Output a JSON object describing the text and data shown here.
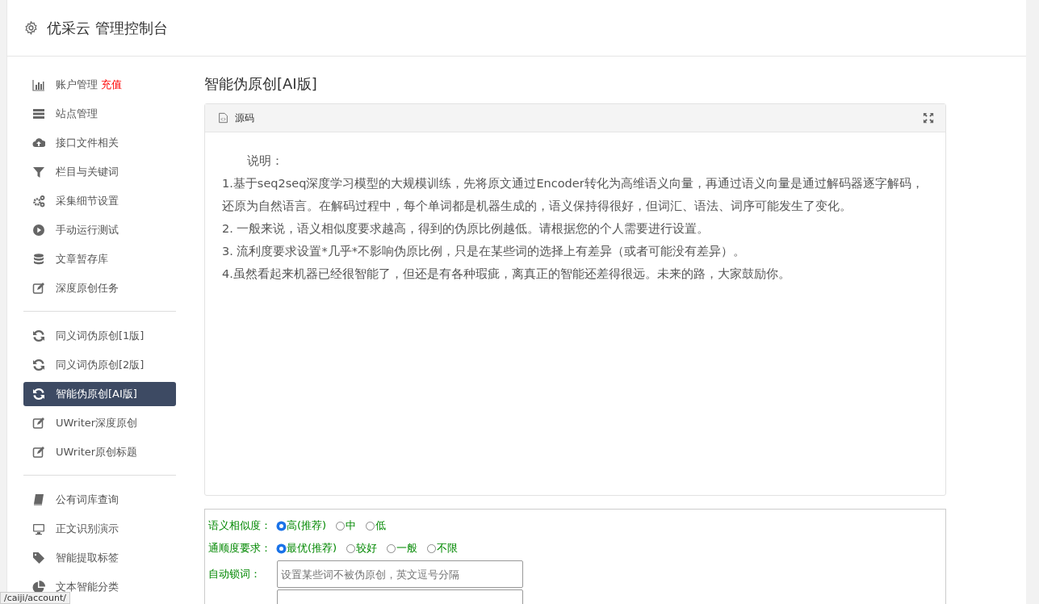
{
  "header": {
    "title": "优采云 管理控制台"
  },
  "sidebar": {
    "groups": [
      {
        "items": [
          {
            "label": "账户管理",
            "badge": "充值",
            "selected": false
          },
          {
            "label": "站点管理",
            "selected": false
          },
          {
            "label": "接口文件相关",
            "selected": false
          },
          {
            "label": "栏目与关键词",
            "selected": false
          },
          {
            "label": "采集细节设置",
            "selected": false
          },
          {
            "label": "手动运行测试",
            "selected": false
          },
          {
            "label": "文章暂存库",
            "selected": false
          },
          {
            "label": "深度原创任务",
            "selected": false
          }
        ]
      },
      {
        "items": [
          {
            "label": "同义词伪原创[1版]",
            "selected": false
          },
          {
            "label": "同义词伪原创[2版]",
            "selected": false
          },
          {
            "label": "智能伪原创[AI版]",
            "selected": true
          },
          {
            "label": "UWriter深度原创",
            "selected": false
          },
          {
            "label": "UWriter原创标题",
            "selected": false
          }
        ]
      },
      {
        "items": [
          {
            "label": "公有词库查询",
            "selected": false
          },
          {
            "label": "正文识别演示",
            "selected": false
          },
          {
            "label": "智能提取标签",
            "selected": false
          },
          {
            "label": "文本智能分类",
            "selected": false
          }
        ]
      }
    ]
  },
  "page_title": "智能伪原创[AI版]",
  "panel": {
    "title": "源码",
    "heading": "说明：",
    "lines": [
      "1.基于seq2seq深度学习模型的大规模训练，先将原文通过Encoder转化为高维语义向量，再通过语义向量是通过解码器逐字解码，还原为自然语言。在解码过程中，每个单词都是机器生成的，语义保持得很好，但词汇、语法、词序可能发生了变化。",
      "2. 一般来说，语义相似度要求越高，得到的伪原比例越低。请根据您的个人需要进行设置。",
      "3. 流利度要求设置*几乎*不影响伪原比例，只是在某些词的选择上有差异（或者可能没有差异）。",
      "4.虽然看起来机器已经很智能了，但还是有各种瑕疵，离真正的智能还差得很远。未来的路，大家鼓励你。"
    ]
  },
  "form": {
    "rows": [
      {
        "kind": "radio",
        "label": "语义相似度：",
        "options": [
          {
            "label": "高(推荐)",
            "selected": true
          },
          {
            "label": "中",
            "selected": false
          },
          {
            "label": "低",
            "selected": false
          }
        ]
      },
      {
        "kind": "radio",
        "label": "通顺度要求：",
        "options": [
          {
            "label": "最优(推荐)",
            "selected": true
          },
          {
            "label": "较好",
            "selected": false
          },
          {
            "label": "一般",
            "selected": false
          },
          {
            "label": "不限",
            "selected": false
          }
        ]
      },
      {
        "kind": "text",
        "label": "自动锁词：",
        "placeholder": "设置某些词不被伪原创，英文逗号分隔"
      },
      {
        "kind": "text"
      }
    ]
  },
  "status_url": "/caiji/account/"
}
